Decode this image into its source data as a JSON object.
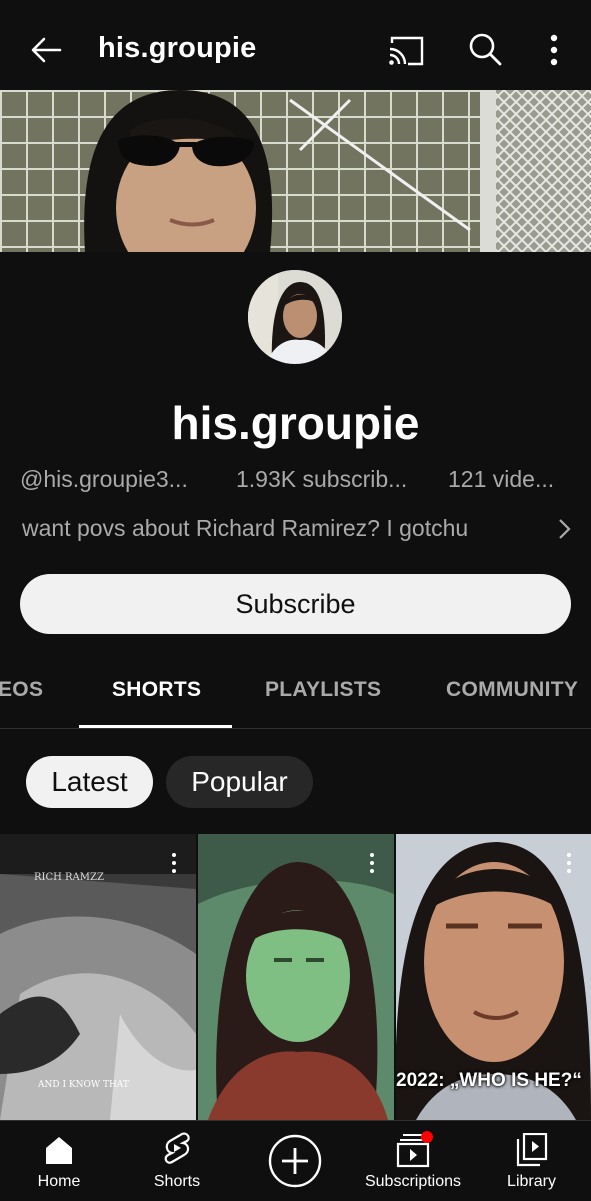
{
  "header": {
    "back_icon": "arrow-left-icon",
    "title": "his.groupie",
    "cast_icon": "cast-icon",
    "search_icon": "search-icon",
    "more_icon": "more-vert-icon"
  },
  "channel": {
    "name": "his.groupie",
    "handle": "@his.groupie3...",
    "subscribers": "1.93K subscrib...",
    "videos": "121 vide...",
    "description": "want povs about Richard Ramirez? I gotchu",
    "subscribe_label": "Subscribe"
  },
  "tabs": [
    {
      "label": "EOS",
      "active": false
    },
    {
      "label": "SHORTS",
      "active": true
    },
    {
      "label": "PLAYLISTS",
      "active": false
    },
    {
      "label": "COMMUNITY",
      "active": false
    }
  ],
  "chips": [
    {
      "label": "Latest",
      "selected": true
    },
    {
      "label": "Popular",
      "selected": false
    }
  ],
  "shorts": [
    {
      "overlay_top": "RICH RAMZZ",
      "overlay_bottom": "AND I KNOW THAT"
    },
    {
      "overlay_top": "",
      "overlay_bottom": ""
    },
    {
      "overlay_top": "",
      "overlay_bottom": "2022: „WHO IS HE?“"
    }
  ],
  "bottom_nav": [
    {
      "label": "Home",
      "icon": "home-icon"
    },
    {
      "label": "Shorts",
      "icon": "shorts-icon"
    },
    {
      "label": "",
      "icon": "create-plus-icon"
    },
    {
      "label": "Subscriptions",
      "icon": "subscriptions-icon"
    },
    {
      "label": "Library",
      "icon": "library-icon"
    }
  ],
  "colors": {
    "background": "#0f0f0f",
    "secondary_text": "#aaaaaa",
    "notification_dot": "#ff0000"
  }
}
